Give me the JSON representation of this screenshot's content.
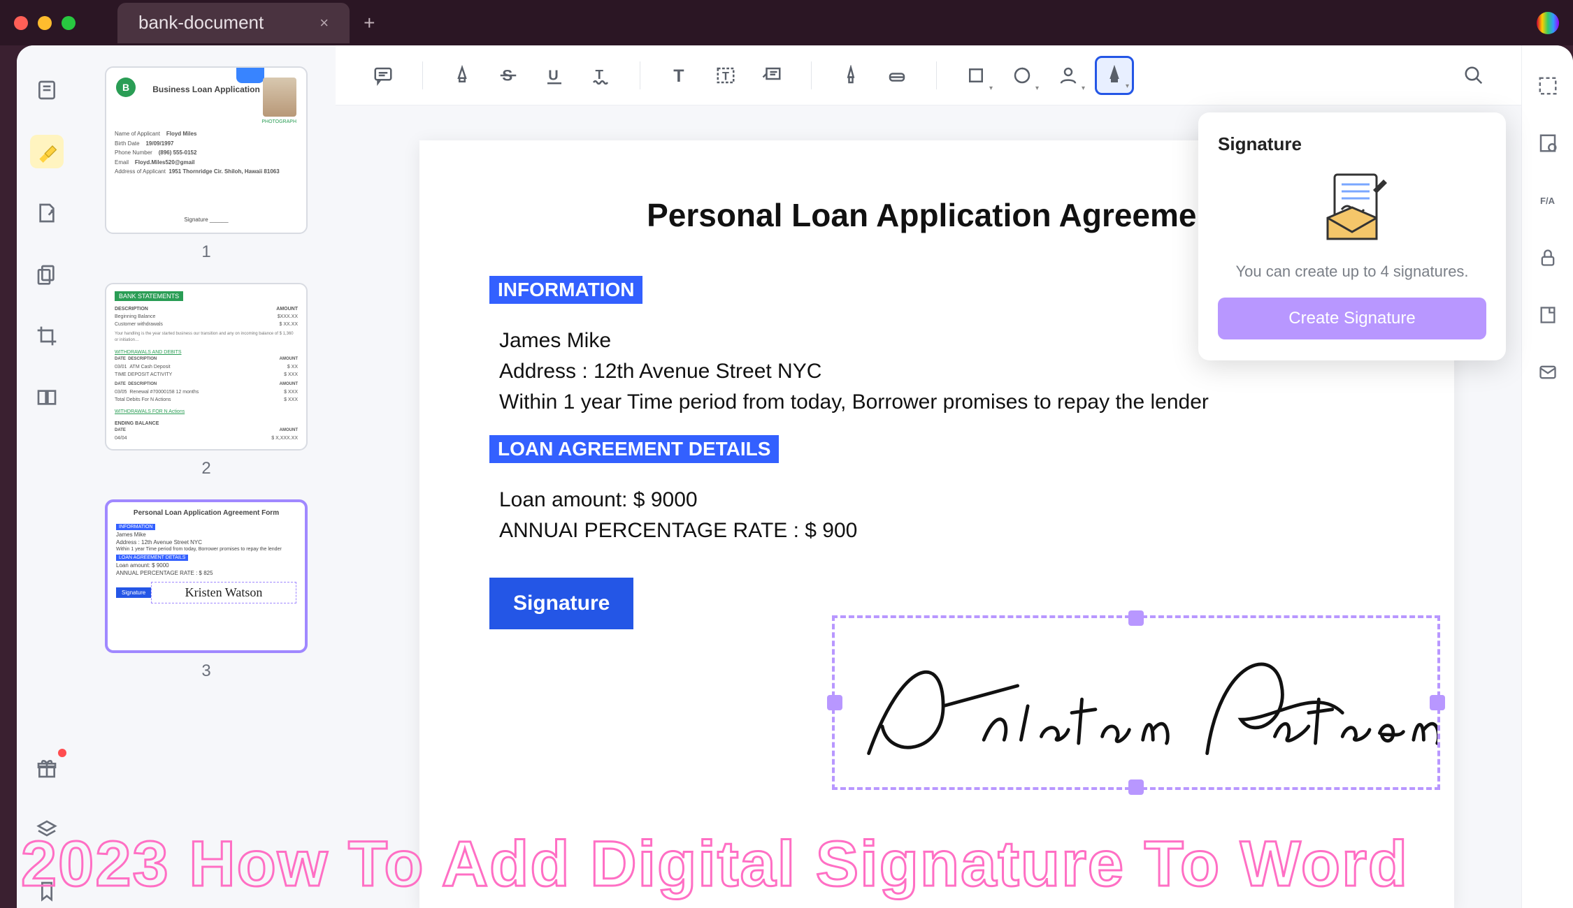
{
  "titlebar": {
    "tab_name": "bank-document",
    "close_glyph": "×",
    "newtab_glyph": "+"
  },
  "left_sidebar_tools": [
    "thumbnails",
    "highlighter",
    "annotate",
    "copy-pages",
    "crop",
    "compare"
  ],
  "thumbnails": [
    {
      "num": "1",
      "title": "Business Loan Application",
      "logo": "B",
      "caption": "PHOTOGRAPH",
      "rows": [
        [
          "Name of Applicant",
          "Floyd Miles"
        ],
        [
          "Birth Date",
          "19/09/1997"
        ],
        [
          "Phone Number",
          "(896) 555-0152"
        ],
        [
          "Email",
          "Floyd.Miles520@gmail"
        ],
        [
          "Address of Applicant",
          "1951 Thornridge Cir. Shiloh, Hawaii 81063"
        ]
      ],
      "sig": "Signature ______"
    },
    {
      "num": "2",
      "badge": "BANK STATEMENTS",
      "rows": [
        {
          "k": "Beginning Balance",
          "v": "$XXX.XX"
        },
        {
          "k": "Customer withdrawals",
          "v": "$ XX.XX"
        },
        {
          "k": "",
          "v": "$ XX.XX"
        }
      ],
      "sections": [
        "WITHDRAWALS AND DEBITS",
        "TIME DEPOSIT ACTIVITY",
        "WITHDRAWALS FOR N Actions"
      ],
      "ending": "ENDING BALANCE"
    },
    {
      "num": "3",
      "title": "Personal Loan Application Agreement Form",
      "infobadge": "INFORMATION",
      "lines": [
        "James Mike",
        "Address : 12th Avenue Street NYC",
        "Within 1 year Time period from today, Borrower promises to repay the lender"
      ],
      "loanbadge": "LOAN AGREEMENT DETAILS",
      "loanlines": [
        "Loan amount: $ 9000",
        "ANNUAL PERCENTAGE RATE : $ 825"
      ],
      "sigbtn": "Signature",
      "signame": "Kristen Watson"
    }
  ],
  "toolbar_buttons": [
    "comment",
    "highlighter",
    "strikethrough",
    "underline",
    "squiggly",
    "text-annot",
    "separator",
    "text",
    "text-box",
    "callout",
    "separator",
    "pencil",
    "eraser",
    "separator",
    "shape",
    "stamp",
    "user",
    "signature"
  ],
  "document": {
    "title": "Personal Loan Application Agreement",
    "section_info": "INFORMATION",
    "name": "James Mike",
    "address": "Address : 12th Avenue Street NYC",
    "promise": "Within 1 year Time period from today, Borrower promises to repay the lender",
    "section_loan": "LOAN AGREEMENT DETAILS",
    "loan_amount": "Loan amount: $ 9000",
    "apr": "ANNUAI PERCENTAGE RATE : $ 900",
    "signature_label": "Signature",
    "signature_text": "Kristen Watson"
  },
  "signature_panel": {
    "title": "Signature",
    "message": "You can create up to 4 signatures.",
    "button": "Create Signature"
  },
  "right_sidebar": [
    "OCR",
    "properties",
    "F/A",
    "lock",
    "attach",
    "mail"
  ],
  "overlay": "2023 How To Add Digital Signature To Word"
}
